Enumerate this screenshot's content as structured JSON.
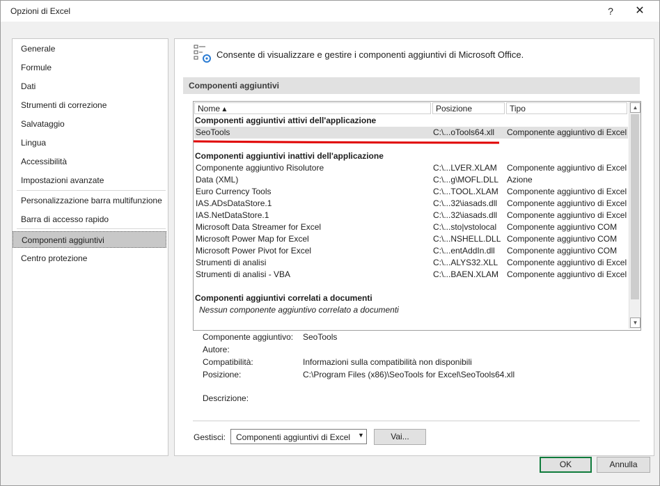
{
  "window": {
    "title": "Opzioni di Excel",
    "help_icon": "question-mark",
    "close_icon": "close"
  },
  "nav": {
    "items": [
      {
        "label": "Generale"
      },
      {
        "label": "Formule"
      },
      {
        "label": "Dati"
      },
      {
        "label": "Strumenti di correzione"
      },
      {
        "label": "Salvataggio"
      },
      {
        "label": "Lingua"
      },
      {
        "label": "Accessibilità"
      },
      {
        "label": "Impostazioni avanzate"
      },
      {
        "label": "Personalizzazione barra multifunzione"
      },
      {
        "label": "Barra di accesso rapido"
      },
      {
        "label": "Componenti aggiuntivi",
        "selected": true
      },
      {
        "label": "Centro protezione"
      }
    ]
  },
  "header": {
    "description": "Consente di visualizzare e gestire i componenti aggiuntivi di Microsoft Office."
  },
  "section": {
    "title": "Componenti aggiuntivi"
  },
  "list": {
    "columns": {
      "name": "Nome ▴",
      "location": "Posizione",
      "type": "Tipo"
    },
    "active_group": "Componenti aggiuntivi attivi dell'applicazione",
    "active": [
      {
        "name": "SeoTools",
        "location": "C:\\...oTools64.xll",
        "type": "Componente aggiuntivo di Excel"
      }
    ],
    "inactive_group": "Componenti aggiuntivi inattivi dell'applicazione",
    "inactive": [
      {
        "name": "Componente aggiuntivo Risolutore",
        "location": "C:\\...LVER.XLAM",
        "type": "Componente aggiuntivo di Excel"
      },
      {
        "name": "Data (XML)",
        "location": "C:\\...g\\MOFL.DLL",
        "type": "Azione"
      },
      {
        "name": "Euro Currency Tools",
        "location": "C:\\...TOOL.XLAM",
        "type": "Componente aggiuntivo di Excel"
      },
      {
        "name": "IAS.ADsDataStore.1",
        "location": "C:\\...32\\iasads.dll",
        "type": "Componente aggiuntivo di Excel"
      },
      {
        "name": "IAS.NetDataStore.1",
        "location": "C:\\...32\\iasads.dll",
        "type": "Componente aggiuntivo di Excel"
      },
      {
        "name": "Microsoft Data Streamer for Excel",
        "location": "C:\\...sto|vstolocal",
        "type": "Componente aggiuntivo COM"
      },
      {
        "name": "Microsoft Power Map for Excel",
        "location": "C:\\...NSHELL.DLL",
        "type": "Componente aggiuntivo COM"
      },
      {
        "name": "Microsoft Power Pivot for Excel",
        "location": "C:\\...entAddIn.dll",
        "type": "Componente aggiuntivo COM"
      },
      {
        "name": "Strumenti di analisi",
        "location": "C:\\...ALYS32.XLL",
        "type": "Componente aggiuntivo di Excel"
      },
      {
        "name": "Strumenti di analisi - VBA",
        "location": "C:\\...BAEN.XLAM",
        "type": "Componente aggiuntivo di Excel"
      }
    ],
    "document_group": "Componenti aggiuntivi correlati a documenti",
    "document_empty": "Nessun componente aggiuntivo correlato a documenti"
  },
  "details": {
    "addin_label": "Componente aggiuntivo:",
    "addin_value": "SeoTools",
    "publisher_label": "Autore:",
    "publisher_value": "",
    "compat_label": "Compatibilità:",
    "compat_value": "Informazioni sulla compatibilità non disponibili",
    "location_label": "Posizione:",
    "location_value": "C:\\Program Files (x86)\\SeoTools for Excel\\SeoTools64.xll",
    "description_label": "Descrizione:",
    "description_value": ""
  },
  "manage": {
    "label": "Gestisci:",
    "selected": "Componenti aggiuntivi di Excel",
    "go_label": "Vai..."
  },
  "buttons": {
    "ok": "OK",
    "cancel": "Annulla"
  },
  "colors": {
    "ok_border": "#0f7b3b",
    "annotation_line": "#e00000",
    "selection": "#c8c8c8"
  }
}
